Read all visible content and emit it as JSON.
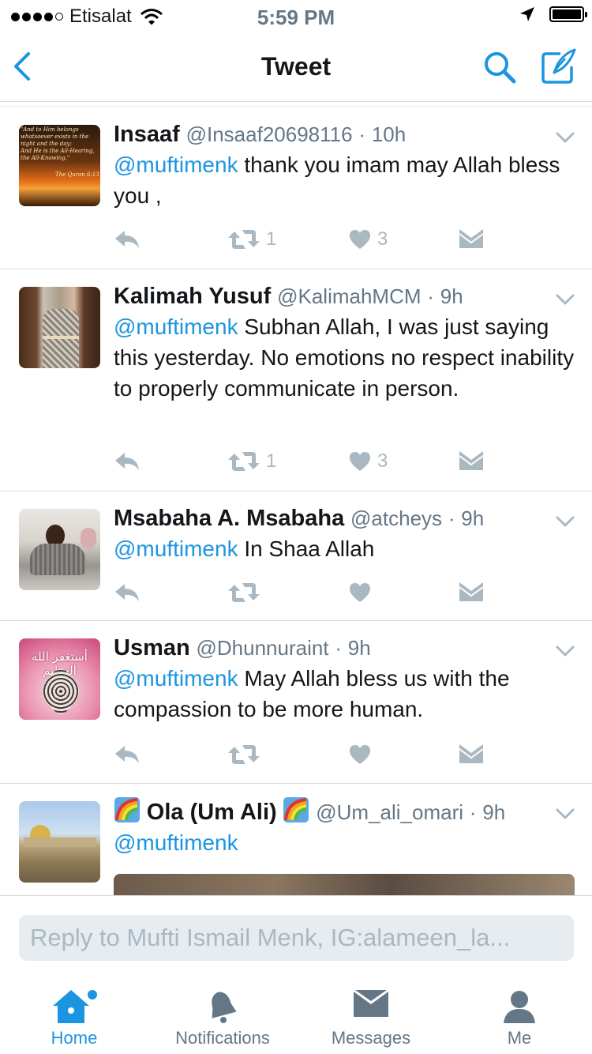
{
  "status_bar": {
    "carrier": "Etisalat",
    "time": "5:59 PM"
  },
  "nav": {
    "title": "Tweet"
  },
  "colors": {
    "accent": "#1b95e0",
    "muted": "#aab8c2",
    "secondary_text": "#657786",
    "separator": "#d6d9dc"
  },
  "tweets": [
    {
      "name": "Insaaf",
      "handle": "@Insaaf20698116",
      "dot": "·",
      "time": "10h",
      "mention": "@muftimenk",
      "text": " thank you imam may Allah bless you ,",
      "retweets": "1",
      "likes": "3",
      "avatar_caption": [
        "\"And to Him belongs",
        "whatsoever exists in the",
        "night and the day;",
        "And He is the All-Hearing,",
        "the All-Knowing.\"",
        "The Quran 6:13"
      ]
    },
    {
      "name": "Kalimah Yusuf",
      "handle": "@KalimahMCM",
      "dot": "·",
      "time": "9h",
      "mention": "@muftimenk",
      "text": " Subhan Allah,  I was just saying this yesterday. No emotions no respect inability to properly communicate in person.",
      "retweets": "1",
      "likes": "3"
    },
    {
      "name": "Msabaha A. Msabaha",
      "handle": "@atcheys",
      "dot": "·",
      "time": "9h",
      "mention": "@muftimenk",
      "text": " In Shaa Allah",
      "retweets": "",
      "likes": ""
    },
    {
      "name": "Usman",
      "handle": "@Dhunnuraint",
      "dot": "·",
      "time": "9h",
      "mention": "@muftimenk",
      "text": " May Allah bless us  with the compassion to be more human.",
      "retweets": "",
      "likes": "",
      "avatar_caption": [
        "أستغفر الله العظيم"
      ]
    },
    {
      "name": "Ola  (Um Ali)",
      "handle": "@Um_ali_omari",
      "dot": "·",
      "time": "9h",
      "mention": "@muftimenk",
      "text": "",
      "name_prefix_icon": "rainbow-emoji",
      "name_suffix_icon": "rainbow-emoji"
    }
  ],
  "reply": {
    "placeholder": "Reply to Mufti Ismail Menk, IG:alameen_la..."
  },
  "tabs": [
    {
      "label": "Home",
      "icon": "home-icon",
      "active": true
    },
    {
      "label": "Notifications",
      "icon": "bell-icon",
      "active": false
    },
    {
      "label": "Messages",
      "icon": "envelope-icon",
      "active": false
    },
    {
      "label": "Me",
      "icon": "person-icon",
      "active": false
    }
  ]
}
